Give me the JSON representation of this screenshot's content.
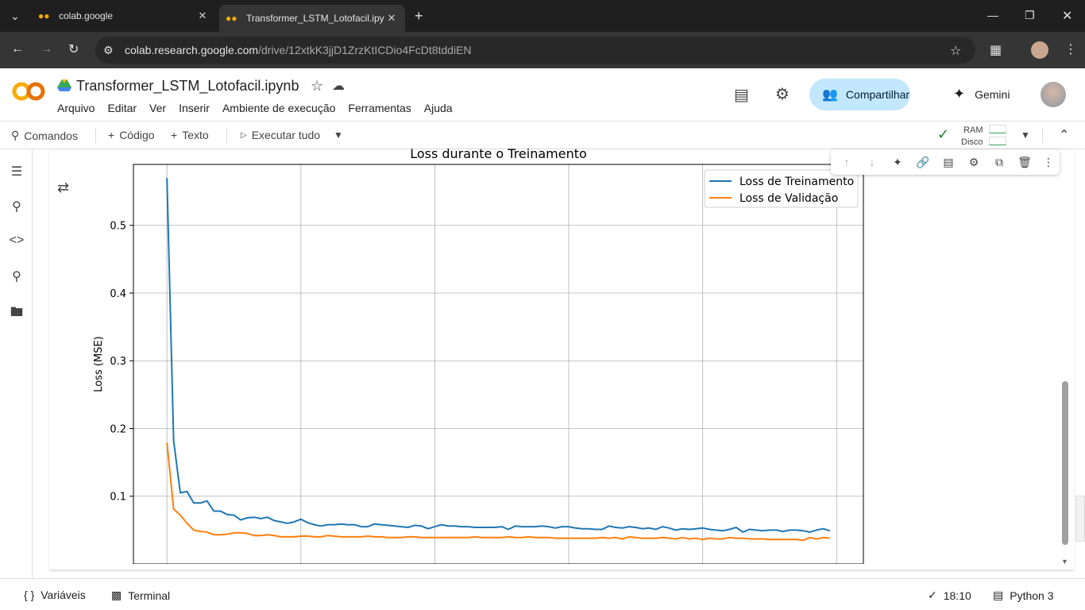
{
  "browser": {
    "tabs": [
      {
        "title": "colab.google",
        "active": false
      },
      {
        "title": "Transformer_LSTM_Lotofacil.ipynb",
        "active": true
      }
    ],
    "url_host": "colab.research.google.com",
    "url_path": "/drive/12xtkK3jjD1ZrzKtICDio4FcDt8tddiEN"
  },
  "header": {
    "notebook_title": "Transformer_LSTM_Lotofacil.ipynb",
    "menu": [
      "Arquivo",
      "Editar",
      "Ver",
      "Inserir",
      "Ambiente de execução",
      "Ferramentas",
      "Ajuda"
    ],
    "share_label": "Compartilhar",
    "gemini_label": "Gemini"
  },
  "toolbar": {
    "commands_label": "Comandos",
    "code_label": "Código",
    "text_label": "Texto",
    "run_all_label": "Executar tudo",
    "ram_label": "RAM",
    "disk_label": "Disco"
  },
  "statusbar": {
    "variables_label": "Variáveis",
    "terminal_label": "Terminal",
    "time": "18:10",
    "runtime": "Python 3"
  },
  "colors": {
    "train": "#1f77b4",
    "val": "#ff7f0e",
    "share_bg": "#c2e7ff"
  },
  "chart_data": {
    "type": "line",
    "title": "Loss durante o Treinamento",
    "xlabel": "",
    "ylabel": "Loss (MSE)",
    "ylim": [
      0.0,
      0.59
    ],
    "yticks": [
      0.1,
      0.2,
      0.3,
      0.4,
      0.5
    ],
    "ytick_labels": [
      "0.1",
      "0.2",
      "0.3",
      "0.4",
      "0.5"
    ],
    "xlim": [
      -5,
      104
    ],
    "xticks": [
      0,
      20,
      40,
      60,
      80,
      100
    ],
    "grid": true,
    "legend_position": "top-right",
    "series": [
      {
        "name": "Loss de Treinamento",
        "color": "#1f77b4",
        "x": [
          0,
          1,
          2,
          3,
          4,
          5,
          6,
          7,
          8,
          9,
          10,
          11,
          12,
          13,
          14,
          15,
          16,
          17,
          18,
          19,
          20,
          21,
          22,
          23,
          24,
          25,
          26,
          27,
          28,
          29,
          30,
          31,
          32,
          33,
          34,
          35,
          36,
          37,
          38,
          39,
          40,
          41,
          42,
          43,
          44,
          45,
          46,
          47,
          48,
          49,
          50,
          51,
          52,
          53,
          54,
          55,
          56,
          57,
          58,
          59,
          60,
          61,
          62,
          63,
          64,
          65,
          66,
          67,
          68,
          69,
          70,
          71,
          72,
          73,
          74,
          75,
          76,
          77,
          78,
          79,
          80,
          81,
          82,
          83,
          84,
          85,
          86,
          87,
          88,
          89,
          90,
          91,
          92,
          93,
          94,
          95,
          96,
          97,
          98,
          99
        ],
        "values": [
          0.57,
          0.182,
          0.105,
          0.107,
          0.09,
          0.09,
          0.093,
          0.078,
          0.078,
          0.073,
          0.072,
          0.065,
          0.068,
          0.069,
          0.067,
          0.069,
          0.064,
          0.062,
          0.06,
          0.062,
          0.066,
          0.061,
          0.058,
          0.056,
          0.058,
          0.058,
          0.059,
          0.058,
          0.058,
          0.055,
          0.055,
          0.059,
          0.058,
          0.057,
          0.056,
          0.055,
          0.054,
          0.057,
          0.056,
          0.052,
          0.055,
          0.058,
          0.056,
          0.056,
          0.055,
          0.055,
          0.054,
          0.054,
          0.054,
          0.054,
          0.055,
          0.051,
          0.056,
          0.055,
          0.055,
          0.055,
          0.056,
          0.055,
          0.053,
          0.055,
          0.055,
          0.053,
          0.052,
          0.052,
          0.051,
          0.051,
          0.056,
          0.054,
          0.053,
          0.055,
          0.054,
          0.052,
          0.053,
          0.051,
          0.055,
          0.053,
          0.05,
          0.052,
          0.051,
          0.052,
          0.053,
          0.051,
          0.05,
          0.049,
          0.051,
          0.054,
          0.047,
          0.051,
          0.05,
          0.049,
          0.05,
          0.05,
          0.048,
          0.05,
          0.05,
          0.049,
          0.047,
          0.05,
          0.052,
          0.049
        ]
      },
      {
        "name": "Loss de Validação",
        "color": "#ff7f0e",
        "x": [
          0,
          1,
          2,
          3,
          4,
          5,
          6,
          7,
          8,
          9,
          10,
          11,
          12,
          13,
          14,
          15,
          16,
          17,
          18,
          19,
          20,
          21,
          22,
          23,
          24,
          25,
          26,
          27,
          28,
          29,
          30,
          31,
          32,
          33,
          34,
          35,
          36,
          37,
          38,
          39,
          40,
          41,
          42,
          43,
          44,
          45,
          46,
          47,
          48,
          49,
          50,
          51,
          52,
          53,
          54,
          55,
          56,
          57,
          58,
          59,
          60,
          61,
          62,
          63,
          64,
          65,
          66,
          67,
          68,
          69,
          70,
          71,
          72,
          73,
          74,
          75,
          76,
          77,
          78,
          79,
          80,
          81,
          82,
          83,
          84,
          85,
          86,
          87,
          88,
          89,
          90,
          91,
          92,
          93,
          94,
          95,
          96,
          97,
          98,
          99
        ],
        "values": [
          0.179,
          0.081,
          0.072,
          0.06,
          0.05,
          0.048,
          0.047,
          0.043,
          0.043,
          0.044,
          0.046,
          0.046,
          0.045,
          0.042,
          0.042,
          0.043,
          0.042,
          0.04,
          0.04,
          0.04,
          0.041,
          0.041,
          0.04,
          0.04,
          0.042,
          0.041,
          0.04,
          0.04,
          0.04,
          0.04,
          0.041,
          0.04,
          0.04,
          0.039,
          0.039,
          0.039,
          0.04,
          0.04,
          0.039,
          0.039,
          0.039,
          0.039,
          0.039,
          0.039,
          0.039,
          0.039,
          0.04,
          0.039,
          0.039,
          0.039,
          0.039,
          0.04,
          0.039,
          0.039,
          0.04,
          0.039,
          0.039,
          0.039,
          0.038,
          0.038,
          0.038,
          0.038,
          0.038,
          0.038,
          0.038,
          0.039,
          0.038,
          0.039,
          0.037,
          0.04,
          0.039,
          0.038,
          0.038,
          0.038,
          0.039,
          0.038,
          0.037,
          0.039,
          0.037,
          0.038,
          0.036,
          0.038,
          0.037,
          0.037,
          0.039,
          0.038,
          0.038,
          0.037,
          0.037,
          0.037,
          0.036,
          0.036,
          0.036,
          0.036,
          0.036,
          0.035,
          0.039,
          0.037,
          0.039,
          0.038
        ]
      }
    ]
  }
}
